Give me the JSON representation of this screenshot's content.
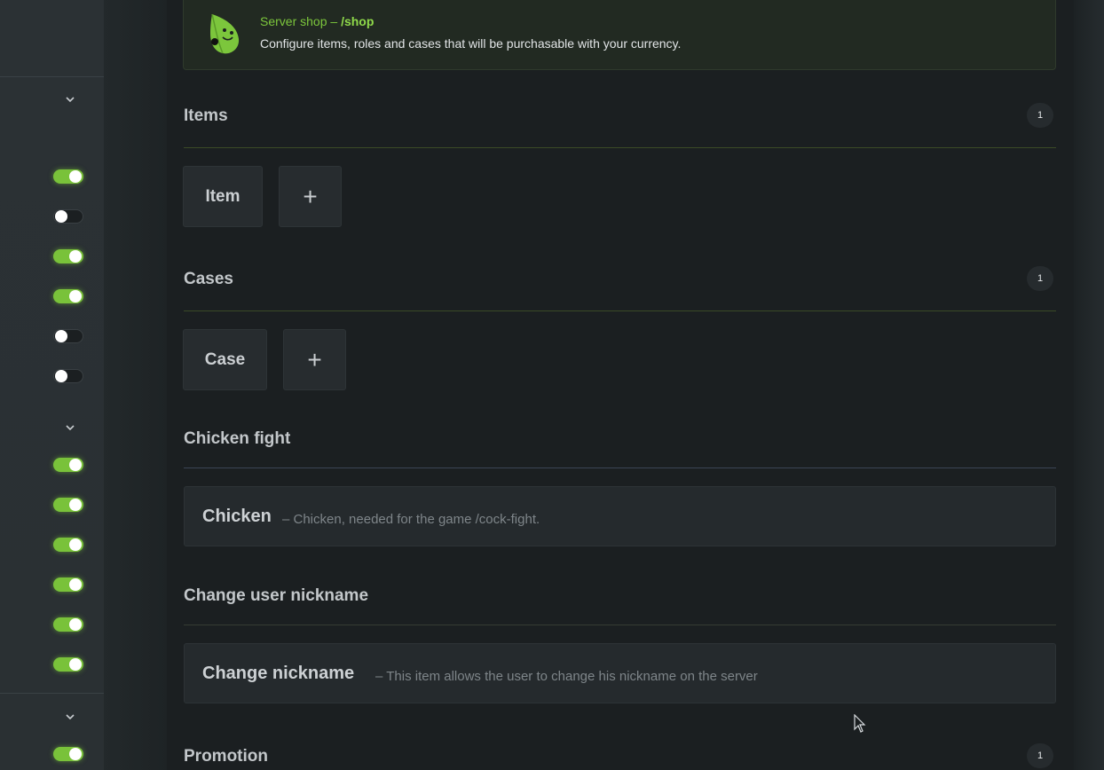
{
  "banner": {
    "title_prefix": "Server shop – ",
    "title_command": "/shop",
    "description": "Configure items, roles and cases that will be purchasable with your currency."
  },
  "sections": {
    "items": {
      "title": "Items",
      "count": "1",
      "tile_label": "Item",
      "add_label": "+"
    },
    "cases": {
      "title": "Cases",
      "count": "1",
      "tile_label": "Case",
      "add_label": "+"
    },
    "chicken_fight": {
      "title": "Chicken fight",
      "item_name": "Chicken",
      "item_desc": "– Chicken, needed for the game /cock-fight."
    },
    "change_nickname": {
      "title": "Change user nickname",
      "item_name": "Change nickname",
      "item_desc": "– This item allows the user to change his nickname on the server"
    },
    "promotion": {
      "title": "Promotion",
      "count": "1"
    }
  },
  "sidebar": {
    "toggles_group1": [
      true,
      false,
      true,
      true,
      false,
      false
    ],
    "toggles_group2": [
      true,
      true,
      true,
      true,
      true,
      true
    ],
    "toggles_group3": [
      true
    ]
  },
  "colors": {
    "accent": "#79c23a",
    "background": "#1b1f21"
  }
}
